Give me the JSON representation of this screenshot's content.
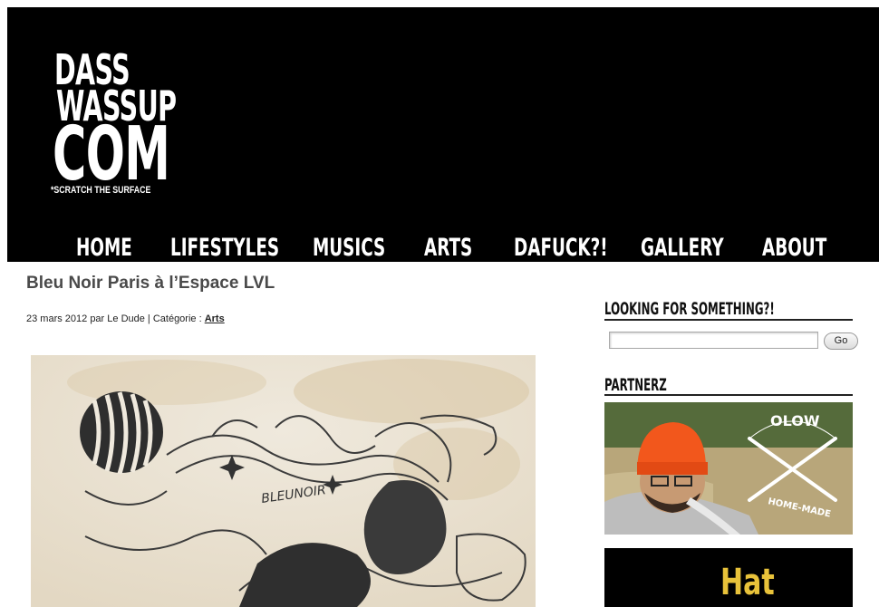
{
  "site": {
    "logo_lines": [
      "DASS",
      "WASSUP",
      "COM"
    ],
    "tagline": "*SCRATCH THE SURFACE"
  },
  "nav": {
    "items": [
      {
        "label": "HOME"
      },
      {
        "label": "LIFESTYLES"
      },
      {
        "label": "MUSICS"
      },
      {
        "label": "ARTS"
      },
      {
        "label": "DAFUCK?!"
      },
      {
        "label": "GALLERY"
      },
      {
        "label": "ABOUT"
      }
    ]
  },
  "post": {
    "title": "Bleu Noir Paris à l’Espace LVL",
    "meta_prefix": "23 mars 2012 par Le Dude | Catégorie : ",
    "category": "Arts",
    "artwork_text": "BLEUNOIR"
  },
  "sidebar": {
    "search_title": "LOOKING FOR SOMETHING?!",
    "search_placeholder": "",
    "search_button": "Go",
    "partners_title": "PARTNERZ",
    "partner1_badge_top": "OLOW",
    "partner1_badge_bottom": "HOME-MADE",
    "partner2_text": "Hat"
  },
  "colors": {
    "header_bg": "#000000",
    "title_text": "#4a4a4a",
    "hat_orange": "#f2571c",
    "hat_gold": "#e8c23a"
  }
}
